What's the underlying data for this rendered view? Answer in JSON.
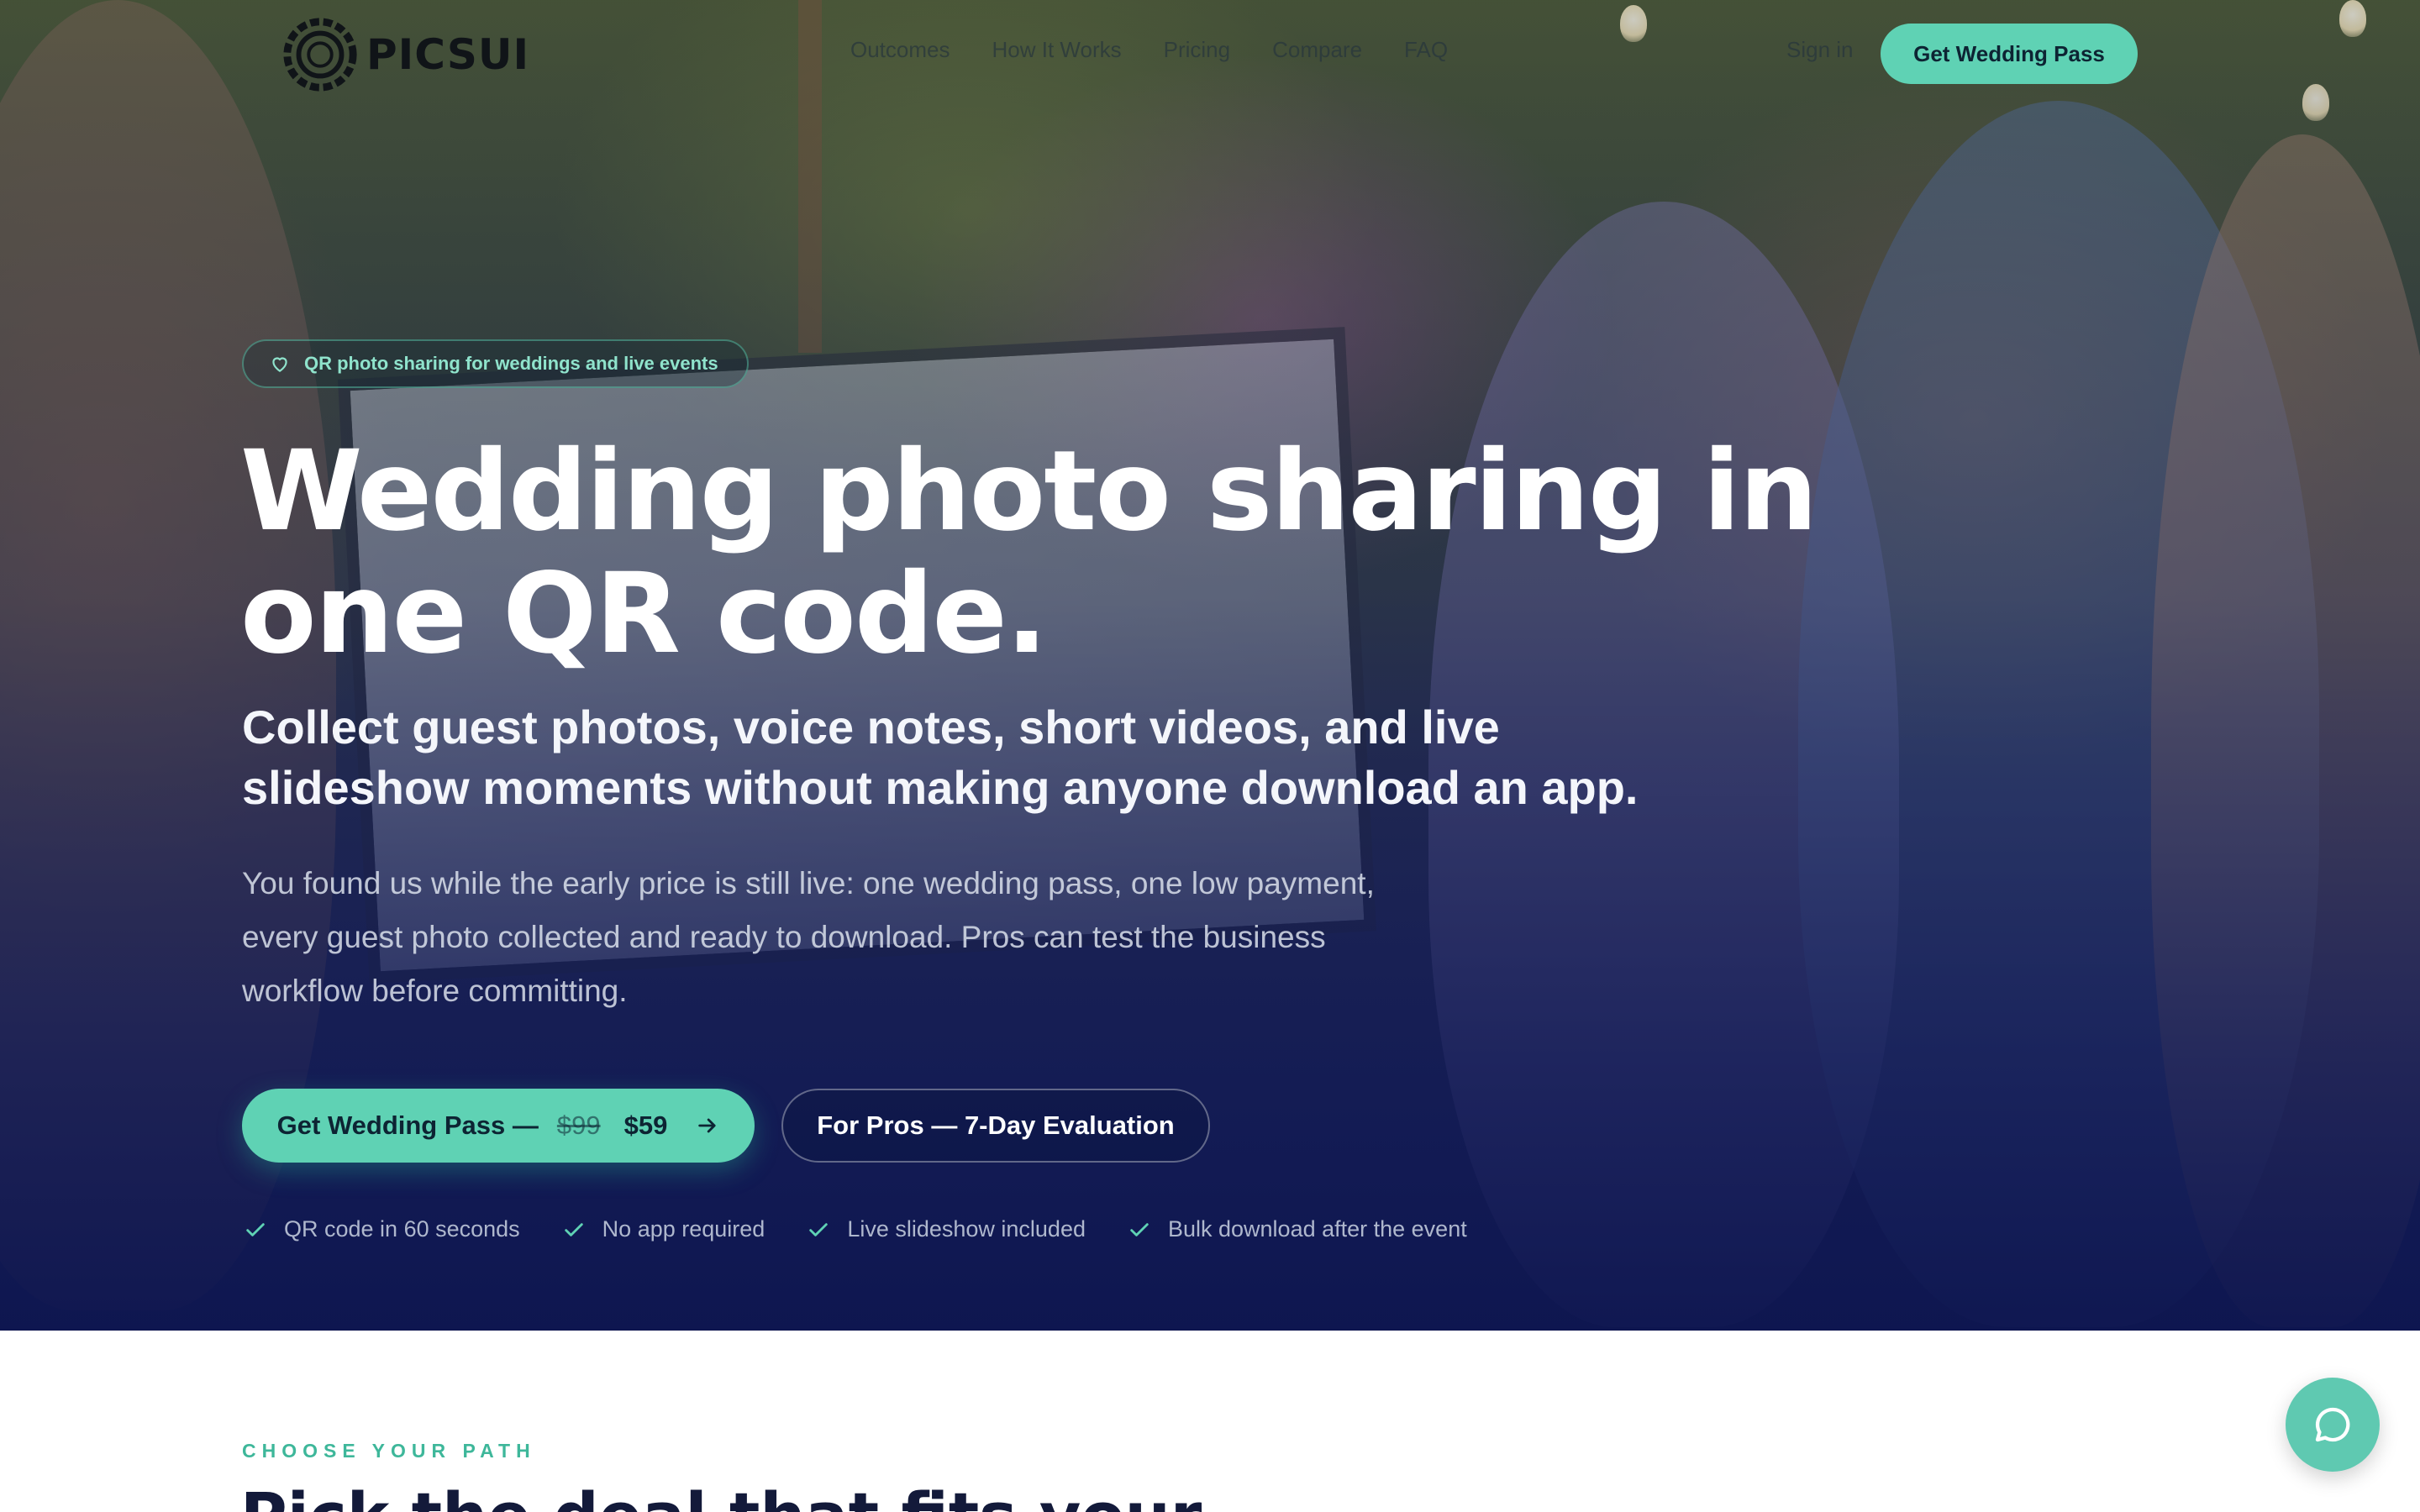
{
  "brand": {
    "name": "PICSUI",
    "accent": "#5fd2b4",
    "hero_bg": "#141c55"
  },
  "nav": {
    "links": [
      "Outcomes",
      "How It Works",
      "Pricing",
      "Compare",
      "FAQ"
    ],
    "signin": "Sign in",
    "cta": "Get Wedding Pass"
  },
  "hero": {
    "badge": "QR photo sharing for weddings and live events",
    "badge_icon": "heart-icon",
    "headline": "Wedding photo sharing in one QR code.",
    "subhead": "Collect guest photos, voice notes, short videos, and live slideshow moments without making anyone download an app.",
    "body": "You found us while the early price is still live: one wedding pass, one low payment, every guest photo collected and ready to download. Pros can test the business workflow before committing.",
    "primary_cta": {
      "label": "Get Wedding Pass —",
      "old_price": "$99",
      "new_price": "$59",
      "icon": "arrow-right-icon"
    },
    "secondary_cta": "For Pros — 7-Day Evaluation",
    "features": [
      "QR code in 60 seconds",
      "No app required",
      "Live slideshow included",
      "Bulk download after the event"
    ]
  },
  "section": {
    "eyebrow": "CHOOSE YOUR PATH",
    "title": "Pick the deal that fits your"
  },
  "chat": {
    "icon": "chat-icon"
  }
}
